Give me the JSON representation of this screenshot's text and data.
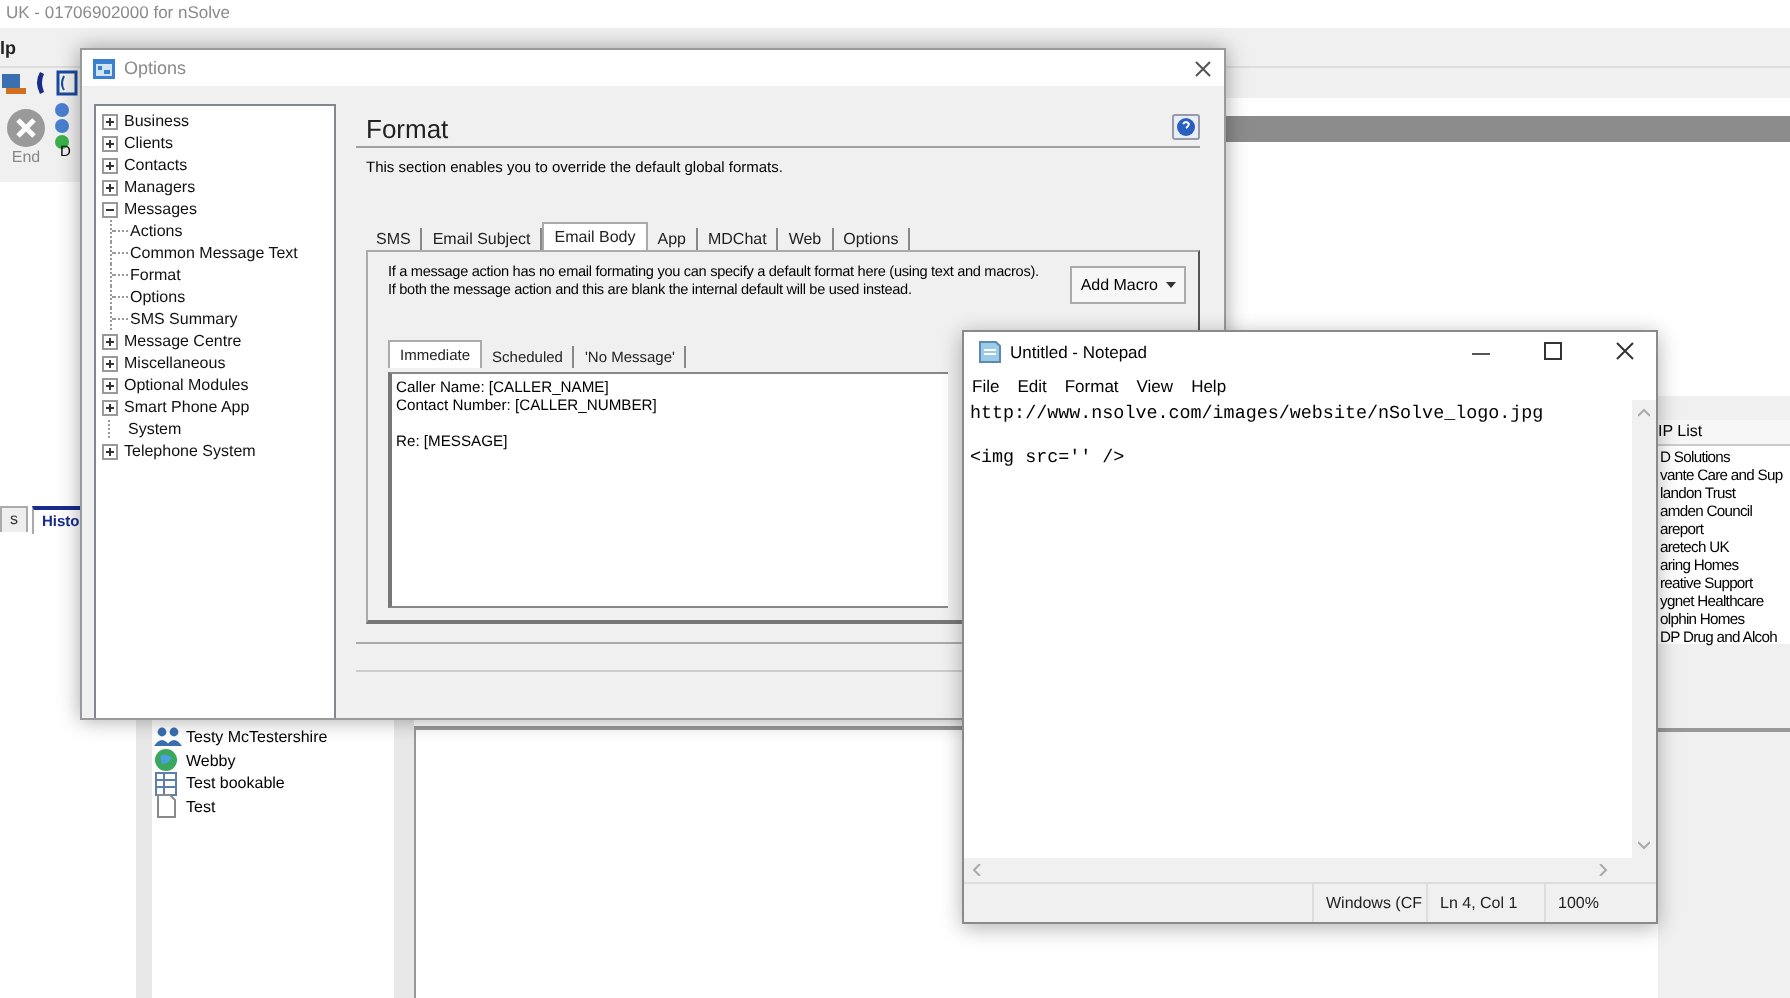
{
  "background_app": {
    "title": "UK - 01706902000 for nSolve",
    "menu": [
      "lp"
    ],
    "end_button": "End",
    "status_label": "D",
    "tabs": [
      {
        "label": "s",
        "selected": false
      },
      {
        "label": "Histo",
        "selected": true
      }
    ],
    "tree_items": [
      {
        "label": "Testy McTestershire",
        "kind": "people"
      },
      {
        "label": "Webby",
        "kind": "globe"
      },
      {
        "label": "Test bookable",
        "kind": "calendar"
      },
      {
        "label": "Test",
        "kind": "page"
      }
    ],
    "vip_list": {
      "title": "IP List",
      "items": [
        "D Solutions",
        "vante Care and Sup",
        "landon Trust",
        "amden Council",
        "areport",
        "aretech UK",
        "aring Homes",
        "reative Support",
        "ygnet Healthcare",
        "olphin Homes",
        "DP Drug and Alcoh"
      ]
    }
  },
  "options_dialog": {
    "title": "Options",
    "tree": [
      {
        "label": "Business",
        "kind": "group",
        "expanded": false
      },
      {
        "label": "Clients",
        "kind": "group",
        "expanded": false
      },
      {
        "label": "Contacts",
        "kind": "group",
        "expanded": false
      },
      {
        "label": "Managers",
        "kind": "group",
        "expanded": false
      },
      {
        "label": "Messages",
        "kind": "group",
        "expanded": true,
        "children": [
          {
            "label": "Actions"
          },
          {
            "label": "Common Message Text"
          },
          {
            "label": "Format"
          },
          {
            "label": "Options"
          },
          {
            "label": "SMS Summary"
          }
        ]
      },
      {
        "label": "Message Centre",
        "kind": "group",
        "expanded": false
      },
      {
        "label": "Miscellaneous",
        "kind": "group",
        "expanded": false
      },
      {
        "label": "Optional Modules",
        "kind": "group",
        "expanded": false
      },
      {
        "label": "Smart Phone App",
        "kind": "group",
        "expanded": false
      },
      {
        "label": "System",
        "kind": "leaf"
      },
      {
        "label": "Telephone System",
        "kind": "group",
        "expanded": false
      }
    ],
    "heading": "Format",
    "description": "This section enables you to override the default global formats.",
    "tabs": [
      {
        "label": "SMS",
        "selected": false
      },
      {
        "label": "Email Subject",
        "selected": false
      },
      {
        "label": "Email Body",
        "selected": true
      },
      {
        "label": "App",
        "selected": false
      },
      {
        "label": "MDChat",
        "selected": false
      },
      {
        "label": "Web",
        "selected": false
      },
      {
        "label": "Options",
        "selected": false
      }
    ],
    "info_lines": [
      "If a message action has no email formating you can specify a default format here (using text and macros).",
      "If both the message action and this are blank the internal default will be used instead."
    ],
    "add_macro_button": "Add Macro",
    "sub_tabs": [
      {
        "label": "Immediate",
        "selected": true
      },
      {
        "label": "Scheduled",
        "selected": false
      },
      {
        "label": "'No Message'",
        "selected": false
      }
    ],
    "body_text": "Caller Name: [CALLER_NAME]\nContact Number: [CALLER_NUMBER]\n\nRe: [MESSAGE]"
  },
  "notepad": {
    "title": "Untitled - Notepad",
    "menu": [
      "File",
      "Edit",
      "Format",
      "View",
      "Help"
    ],
    "content": "http://www.nsolve.com/images/website/nSolve_logo.jpg\n\n<img src='' />",
    "status": [
      "Windows (CF",
      "Ln 4, Col 1",
      "100%"
    ]
  }
}
